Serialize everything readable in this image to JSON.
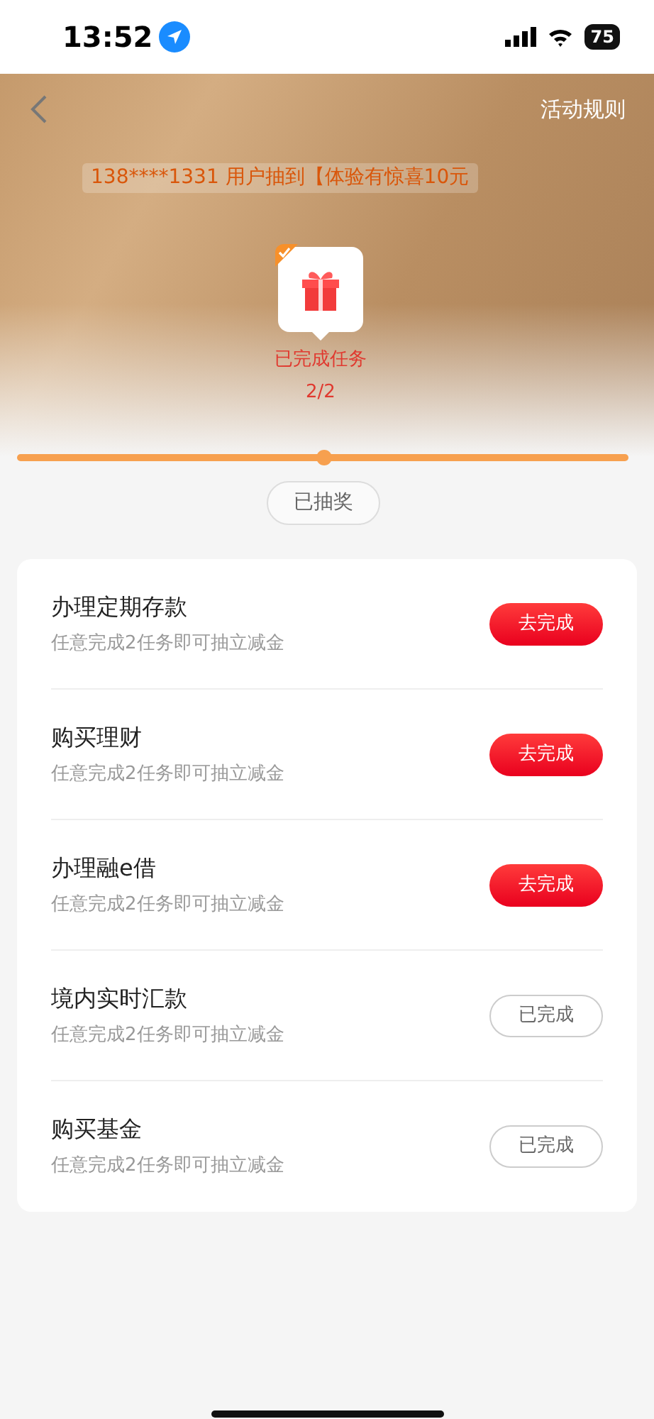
{
  "status_bar": {
    "time": "13:52",
    "battery": "75"
  },
  "header": {
    "rules_link": "活动规则",
    "ticker": "138****1331 用户抽到【体验有惊喜10元"
  },
  "milestone": {
    "checked": true,
    "label": "已完成任务",
    "count": "2/2"
  },
  "draw_status": "已抽奖",
  "tasks": [
    {
      "title": "办理定期存款",
      "subtitle": "任意完成2任务即可抽立减金",
      "button": "去完成",
      "done": false
    },
    {
      "title": "购买理财",
      "subtitle": "任意完成2任务即可抽立减金",
      "button": "去完成",
      "done": false
    },
    {
      "title": "办理融e借",
      "subtitle": "任意完成2任务即可抽立减金",
      "button": "去完成",
      "done": false
    },
    {
      "title": "境内实时汇款",
      "subtitle": "任意完成2任务即可抽立减金",
      "button": "已完成",
      "done": true
    },
    {
      "title": "购买基金",
      "subtitle": "任意完成2任务即可抽立减金",
      "button": "已完成",
      "done": true
    }
  ]
}
